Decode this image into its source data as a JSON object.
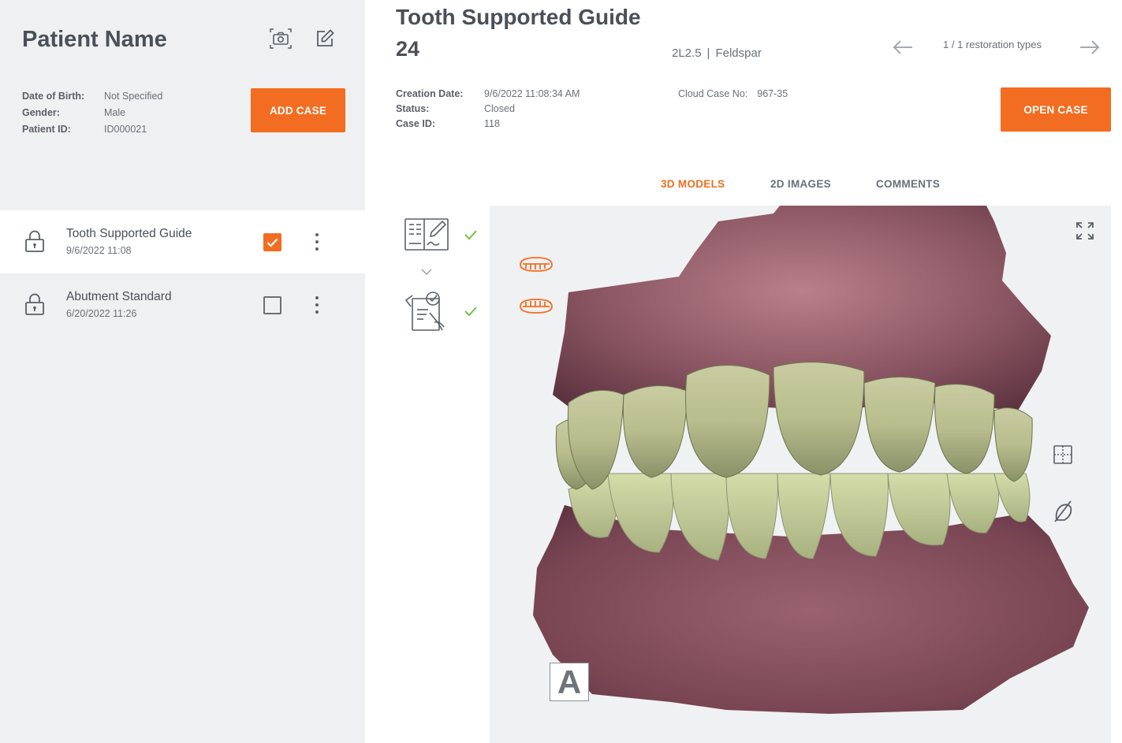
{
  "patient": {
    "name": "Patient Name",
    "fields": [
      {
        "label": "Date of Birth:",
        "value": "Not Specified"
      },
      {
        "label": "Gender:",
        "value": "Male"
      },
      {
        "label": "Patient ID:",
        "value": "ID000021"
      }
    ],
    "add_case_label": "ADD CASE"
  },
  "cases": [
    {
      "title": "Tooth Supported Guide",
      "date": "9/6/2022 11:08",
      "checked": true,
      "locked": true
    },
    {
      "title": "Abutment Standard",
      "date": "6/20/2022 11:26",
      "checked": false,
      "locked": true
    }
  ],
  "case_detail": {
    "title": "Tooth Supported Guide",
    "tooth_number": "24",
    "restoration_shade": "2L2.5",
    "restoration_material": "Feldspar",
    "restoration_separator": "|",
    "restoration_nav": "1 / 1 restoration types",
    "meta": [
      {
        "label": "Creation Date:",
        "value": "9/6/2022 11:08:34 AM"
      },
      {
        "label": "Status:",
        "value": "Closed"
      },
      {
        "label": "Case ID:",
        "value": "118"
      }
    ],
    "cloud_case": {
      "label": "Cloud Case No:",
      "value": "967-35"
    },
    "open_case_label": "OPEN CASE"
  },
  "tabs": [
    {
      "label": "3D MODELS",
      "active": true
    },
    {
      "label": "2D IMAGES",
      "active": false
    },
    {
      "label": "COMMENTS",
      "active": false
    }
  ],
  "workflow": {
    "steps": [
      {
        "icon": "design-form-icon",
        "completed": true
      },
      {
        "icon": "approval-clipboard-icon",
        "completed": true
      }
    ]
  },
  "viewer": {
    "orientation_label": "A",
    "jaw_toggles": [
      "upper-jaw-icon",
      "lower-jaw-icon"
    ],
    "tools": [
      "fullscreen-icon",
      "section-view-icon",
      "visibility-off-icon"
    ]
  },
  "colors": {
    "accent": "#f26d21",
    "check_green": "#7ac143",
    "sidebar_bg": "#eff0f1",
    "text_dark": "#4a5058"
  }
}
